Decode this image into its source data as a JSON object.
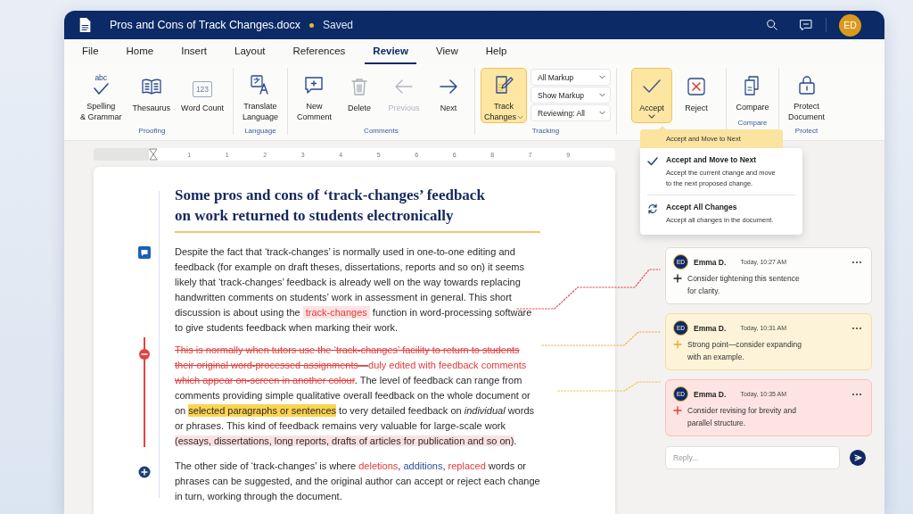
{
  "window": {
    "title": "Pros and Cons of Track Changes.docx",
    "status": "Saved",
    "avatar": "ED"
  },
  "menu": [
    {
      "label": "File",
      "selected": false
    },
    {
      "label": "Home",
      "selected": false
    },
    {
      "label": "Insert",
      "selected": false
    },
    {
      "label": "Layout",
      "selected": false
    },
    {
      "label": "References",
      "selected": false
    },
    {
      "label": "Review",
      "selected": true
    },
    {
      "label": "View",
      "selected": false
    },
    {
      "label": "Help",
      "selected": false
    }
  ],
  "ribbon": {
    "groups": [
      {
        "label": "Proofing",
        "items": [
          {
            "kind": "spelling",
            "icon_text": "abc",
            "label": "Spelling\n& Grammar",
            "selected": false,
            "disabled": false,
            "caret": false
          },
          {
            "kind": "thesaurus",
            "label": "Thesaurus",
            "selected": false,
            "disabled": false,
            "caret": false
          },
          {
            "kind": "word-count",
            "icon_text": "123",
            "label": "Word Count",
            "selected": false,
            "disabled": false,
            "caret": false
          }
        ]
      },
      {
        "label": "Language",
        "items": [
          {
            "kind": "translate",
            "label": "Translate\nLanguage",
            "selected": false,
            "disabled": false,
            "caret": false
          }
        ]
      },
      {
        "label": "Comments",
        "items": [
          {
            "kind": "new-comment",
            "label": "New\nComment",
            "selected": false,
            "disabled": false,
            "caret": false
          },
          {
            "kind": "delete",
            "label": "Delete",
            "selected": false,
            "disabled": false,
            "caret": false
          },
          {
            "kind": "previous",
            "label": "Previous",
            "selected": false,
            "disabled": true,
            "caret": false
          },
          {
            "kind": "next",
            "label": "Next",
            "selected": false,
            "disabled": false,
            "caret": false
          }
        ]
      },
      {
        "label": "Tracking",
        "items": [
          {
            "kind": "track",
            "label": "Track\nChanges",
            "selected": true,
            "disabled": false,
            "caret": true
          }
        ],
        "selects": [
          "All Markup",
          "Show Markup",
          "Reviewing: All"
        ]
      },
      {
        "items": [
          {
            "kind": "accept",
            "label": "Accept",
            "selected": true,
            "disabled": false,
            "caret": true
          },
          {
            "kind": "reject",
            "label": "Reject",
            "selected": false,
            "disabled": false,
            "caret": false
          }
        ]
      },
      {
        "label": "Compare",
        "items": [
          {
            "kind": "compare",
            "label": "Compare",
            "selected": false,
            "disabled": false,
            "caret": false
          }
        ]
      },
      {
        "label": "Protect",
        "items": [
          {
            "kind": "protect",
            "label": "Protect\nDocument",
            "selected": false,
            "disabled": false,
            "caret": false
          }
        ]
      }
    ]
  },
  "accept_menu": {
    "tooltip": "Accept and Move to Next",
    "items": [
      {
        "kind": "check",
        "title": "Accept and Move to Next",
        "description": "Accept the current change and move to the next proposed change."
      },
      {
        "kind": "cycle",
        "title": "Accept All Changes",
        "description": "Accept all changes in the document."
      }
    ]
  },
  "ruler": {
    "ticks": [
      "1",
      "1",
      "2",
      "3",
      "4",
      "5",
      "6",
      "6",
      "8",
      "7",
      "9"
    ]
  },
  "document": {
    "title_lines": [
      "Some pros and cons of ‘track-changes’ feedback",
      "on work returned to students electronically"
    ],
    "paragraphs": [
      {
        "kind": "comment",
        "runs": [
          {
            "kind": "text",
            "text": "Despite the fact that ‘track-changes’ is normally used in one-to-one editing and feedback (for example on draft theses, dissertations, reports and so on) it seems likely that ‘track-changes’ feedback is already well on the way towards replacing handwritten comments on students’ work in assessment in general. This short discussion is about using the "
          },
          {
            "kind": "tracked",
            "text": "track-changes"
          },
          {
            "kind": "text",
            "text": " function in word-processing software to give students feedback when marking their work."
          }
        ]
      },
      {
        "kind": "deletion",
        "runs": [
          {
            "kind": "deleted",
            "text": "This is normally when tutors use the ‘track-changes’ facility to return to students their original word-processed assignments—"
          },
          {
            "kind": "red",
            "text": "duly edited with feedback comments "
          },
          {
            "kind": "deleted",
            "text": "which appear on-screen in another colour"
          },
          {
            "kind": "text",
            "text": ". The level of feedback can range from comments providing simple qualitative overall feedback on the whole document or on "
          },
          {
            "kind": "highlight",
            "text": "selected paragraphs or sentences"
          },
          {
            "kind": "text",
            "text": " to very detailed feedback on "
          },
          {
            "kind": "italic",
            "text": "individual"
          },
          {
            "kind": "text",
            "text": " words or phrases. This kind of feedback remains very valuable for large-scale work "
          },
          {
            "kind": "shaded",
            "text": "(essays, dissertations, long reports, drafts of articles for publication and so on)"
          },
          {
            "kind": "text",
            "text": "."
          }
        ]
      },
      {
        "kind": "insertion",
        "runs": [
          {
            "kind": "text",
            "text": "The other side of ‘track-changes’ is where "
          },
          {
            "kind": "red",
            "text": "deletions"
          },
          {
            "kind": "text",
            "text": ", "
          },
          {
            "kind": "blue",
            "text": "additions"
          },
          {
            "kind": "text",
            "text": ", "
          },
          {
            "kind": "red",
            "text": "replaced"
          },
          {
            "kind": "text",
            "text": " words or phrases can be suggested, and the original author can accept or reject each change in turn, working through the document."
          }
        ]
      }
    ]
  },
  "comments": [
    {
      "kind": "note",
      "author": "Emma D.",
      "avatar": "ED",
      "time": "Today, 10:27 AM",
      "text": "Consider tightening this sentence for clarity."
    },
    {
      "kind": "suggestion",
      "author": "Emma D.",
      "avatar": "ED",
      "time": "Today, 10:31 AM",
      "text": "Strong point—consider expanding with an example."
    },
    {
      "kind": "revision",
      "author": "Emma D.",
      "avatar": "ED",
      "time": "Today, 10:35 AM",
      "text": "Consider revising for brevity and parallel structure."
    }
  ],
  "reply": {
    "placeholder": "Reply..."
  }
}
